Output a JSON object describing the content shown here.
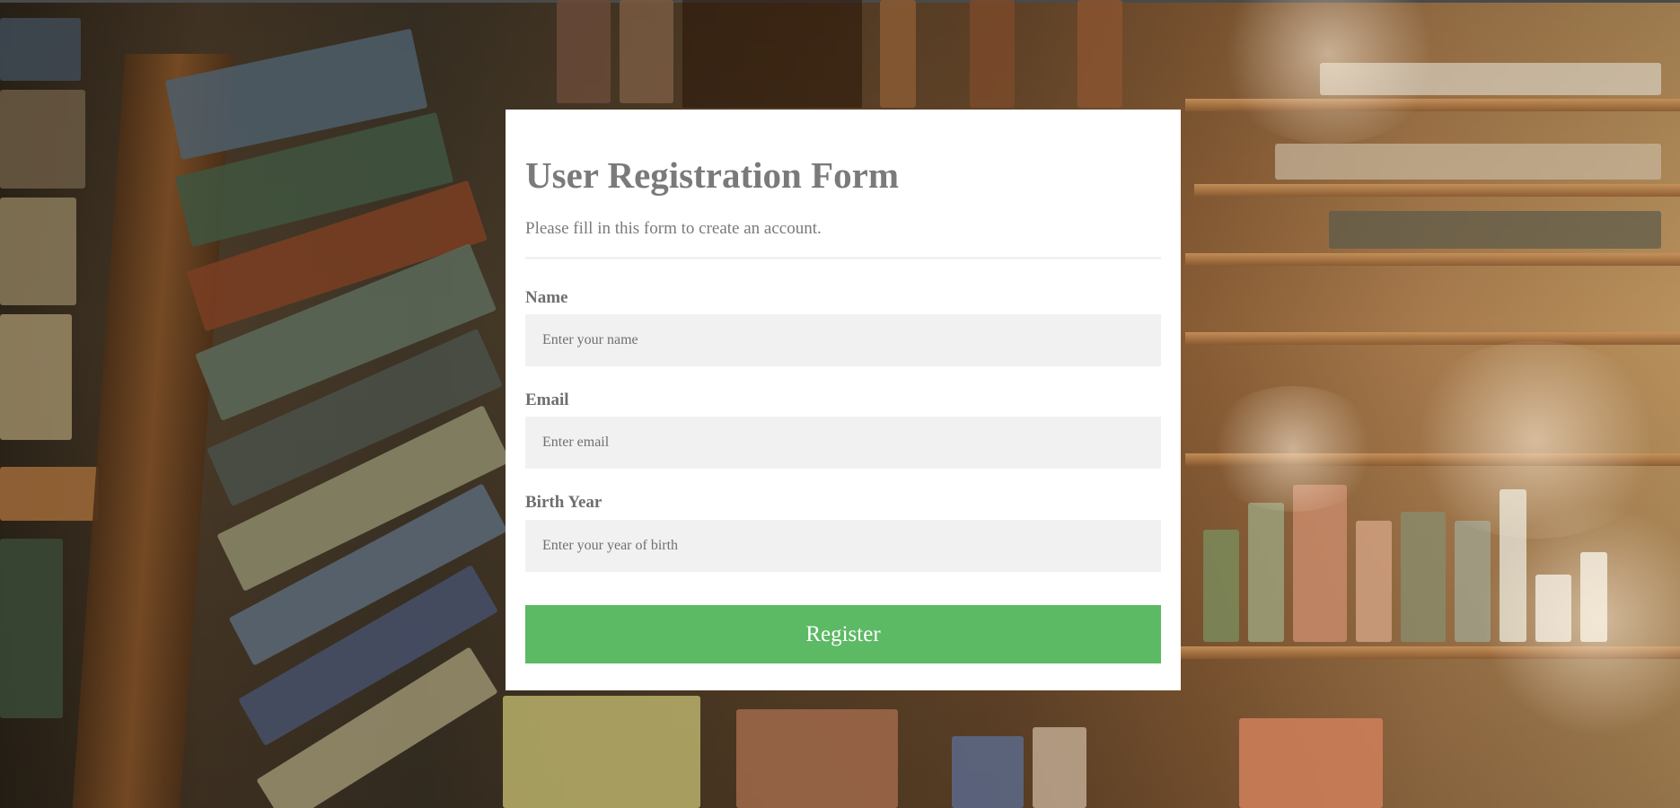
{
  "form": {
    "title": "User Registration Form",
    "subtitle": "Please fill in this form to create an account.",
    "fields": [
      {
        "label": "Name",
        "placeholder": "Enter your name",
        "value": ""
      },
      {
        "label": "Email",
        "placeholder": "Enter email",
        "value": ""
      },
      {
        "label": "Birth Year",
        "placeholder": "Enter your year of birth",
        "value": ""
      }
    ],
    "submit_label": "Register"
  },
  "colors": {
    "card_background": "#ffffff",
    "heading_text": "#7a7a7a",
    "input_background": "#f1f1f1",
    "button_background": "#5cb964",
    "button_text": "#ffffff"
  }
}
